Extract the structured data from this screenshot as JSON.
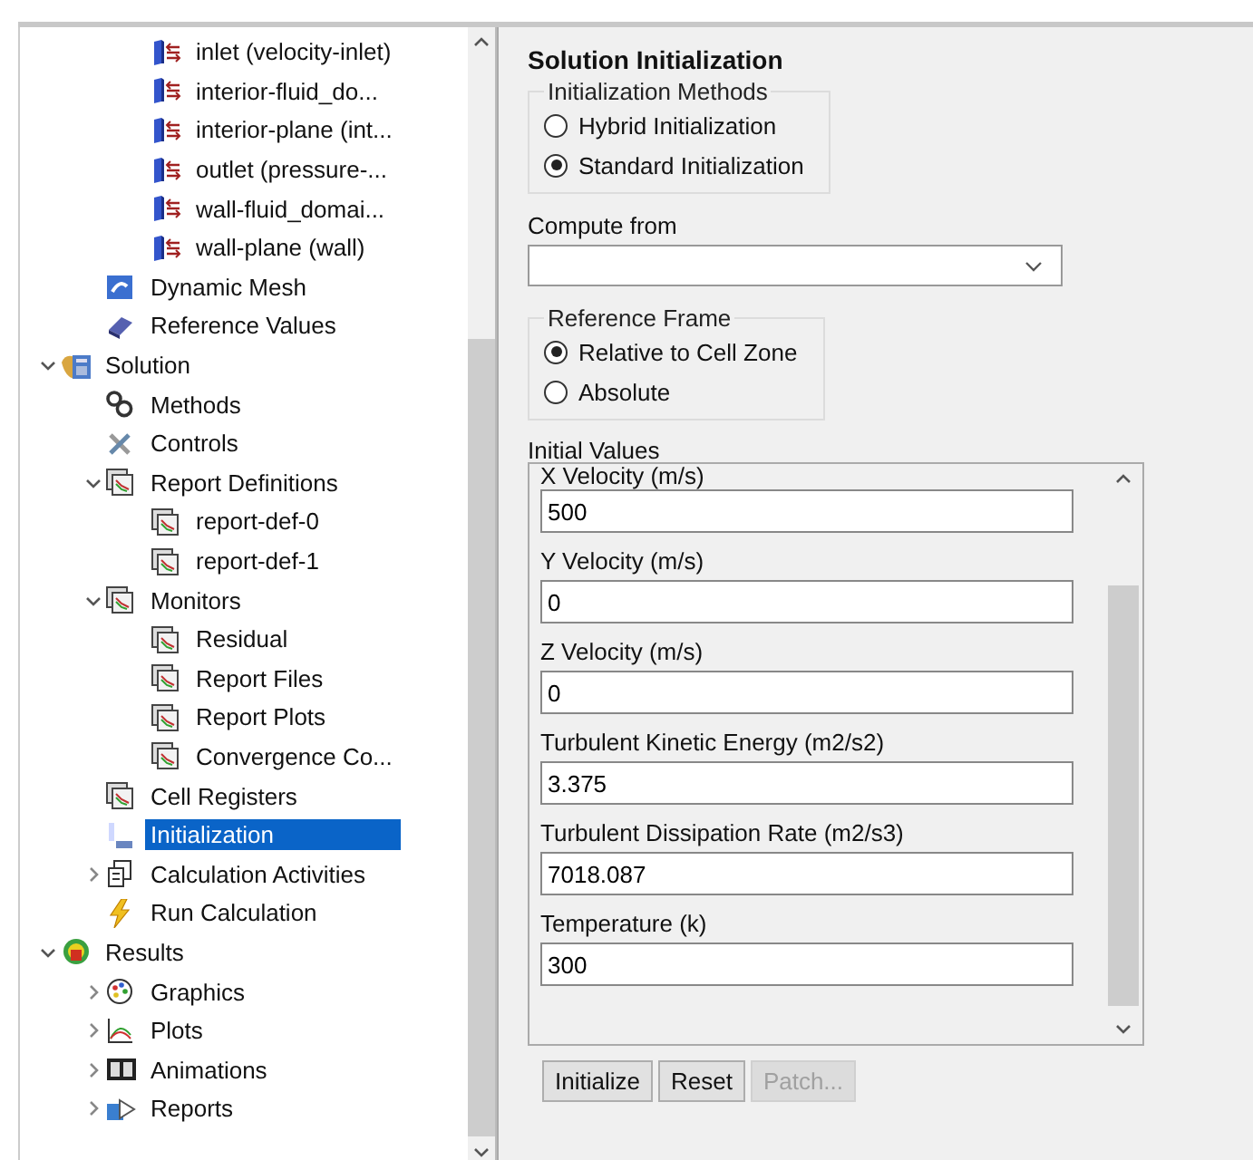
{
  "tree": [
    {
      "children": [
        {
          "children": [
            {
              "label": "inlet (velocity-inlet)",
              "kind": "boundary",
              "selected": false
            },
            {
              "label": "interior-fluid_do...",
              "kind": "boundary",
              "selected": false
            },
            {
              "label": "interior-plane (int...",
              "kind": "boundary",
              "selected": false
            },
            {
              "label": "outlet (pressure-...",
              "kind": "boundary",
              "selected": false
            },
            {
              "label": "wall-fluid_domai...",
              "kind": "boundary",
              "selected": false
            },
            {
              "label": "wall-plane (wall)",
              "kind": "boundary",
              "selected": false
            }
          ]
        },
        {
          "label": "Dynamic Mesh",
          "kind": "mesh",
          "selected": false
        },
        {
          "label": "Reference Values",
          "kind": "values",
          "selected": false
        }
      ]
    },
    {
      "label": "Solution",
      "kind": "solution",
      "selected": false,
      "expanded": true,
      "children": [
        {
          "label": "Methods",
          "kind": "methods",
          "selected": false
        },
        {
          "label": "Controls",
          "kind": "controls",
          "selected": false
        },
        {
          "label": "Report Definitions",
          "kind": "report",
          "selected": false,
          "expanded": true,
          "children": [
            {
              "label": "report-def-0",
              "kind": "report",
              "selected": false
            },
            {
              "label": "report-def-1",
              "kind": "report",
              "selected": false
            }
          ]
        },
        {
          "label": "Monitors",
          "kind": "report",
          "selected": false,
          "expanded": true,
          "children": [
            {
              "label": "Residual",
              "kind": "report",
              "selected": false
            },
            {
              "label": "Report Files",
              "kind": "report",
              "selected": false
            },
            {
              "label": "Report Plots",
              "kind": "report",
              "selected": false
            },
            {
              "label": "Convergence Co...",
              "kind": "report",
              "selected": false
            }
          ]
        },
        {
          "label": "Cell Registers",
          "kind": "report",
          "selected": false
        },
        {
          "label": "Initialization",
          "kind": "init",
          "selected": true
        },
        {
          "label": "Calculation Activities",
          "kind": "activities",
          "selected": false,
          "expanded": false
        },
        {
          "label": "Run Calculation",
          "kind": "run",
          "selected": false
        }
      ]
    },
    {
      "label": "Results",
      "kind": "results",
      "selected": false,
      "expanded": true,
      "children": [
        {
          "label": "Graphics",
          "kind": "graphics",
          "selected": false,
          "expanded": false
        },
        {
          "label": "Plots",
          "kind": "plots",
          "selected": false,
          "expanded": false
        },
        {
          "label": "Animations",
          "kind": "animations",
          "selected": false,
          "expanded": false
        },
        {
          "label": "Reports",
          "kind": "reports",
          "selected": false,
          "expanded": false
        }
      ]
    }
  ],
  "panel": {
    "title": "Solution Initialization",
    "methods": {
      "title": "Initialization Methods",
      "options": [
        {
          "label": "Hybrid  Initialization",
          "selected": false
        },
        {
          "label": "Standard Initialization",
          "selected": true
        }
      ]
    },
    "compute_from": {
      "label": "Compute from"
    },
    "reference_frame": {
      "title": "Reference Frame",
      "options": [
        {
          "label": "Relative to Cell Zone",
          "selected": true
        },
        {
          "label": "Absolute",
          "selected": false
        }
      ]
    },
    "initial_values": {
      "title": "Initial Values",
      "fields": [
        {
          "label": "X Velocity (m/s)",
          "value": "500"
        },
        {
          "label": "Y Velocity (m/s)",
          "value": "0"
        },
        {
          "label": "Z Velocity (m/s)",
          "value": "0"
        },
        {
          "label": "Turbulent Kinetic Energy (m2/s2)",
          "value": "3.375"
        },
        {
          "label": "Turbulent Dissipation Rate (m2/s3)",
          "value": "7018.087"
        },
        {
          "label": "Temperature (k)",
          "value": "300"
        }
      ]
    },
    "buttons": [
      {
        "label": "Initialize",
        "disabled": false
      },
      {
        "label": "Reset",
        "disabled": false
      },
      {
        "label": "Patch...",
        "disabled": true
      }
    ]
  }
}
